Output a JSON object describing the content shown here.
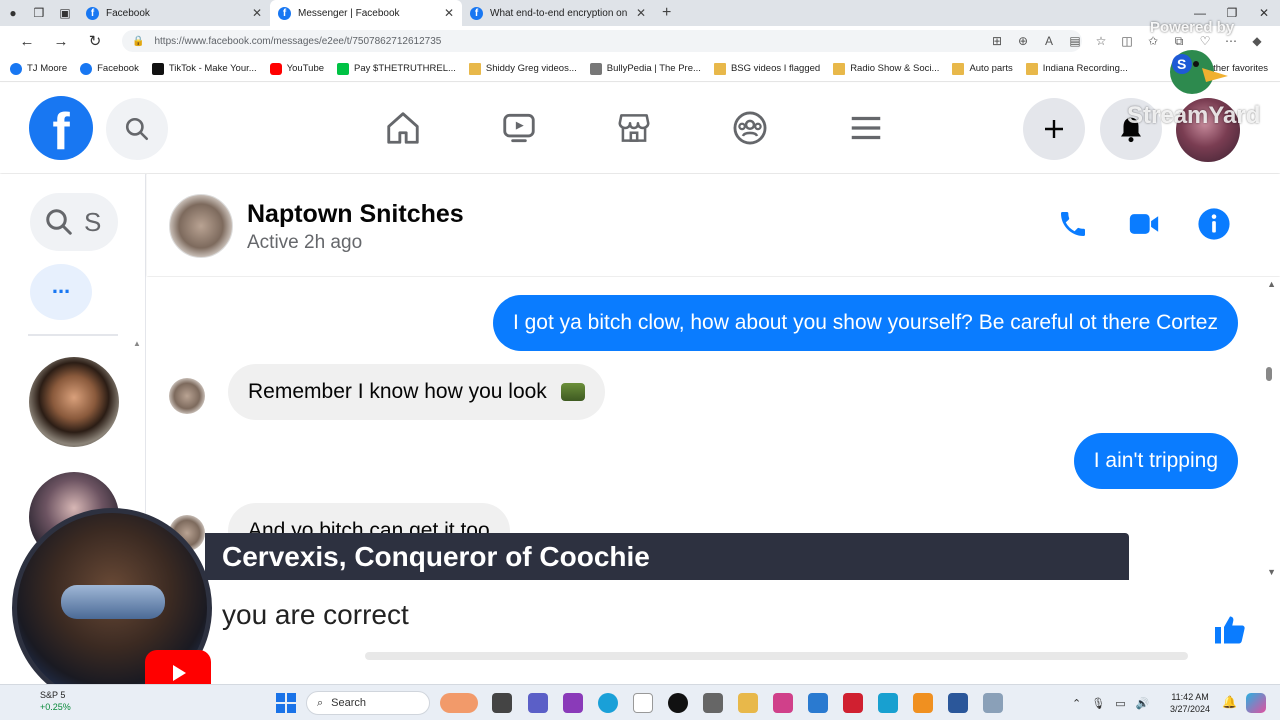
{
  "browser": {
    "tabs": [
      {
        "title": "Facebook",
        "active": false
      },
      {
        "title": "Messenger | Facebook",
        "active": true
      },
      {
        "title": "What end-to-end encryption on",
        "active": false
      }
    ],
    "url": "https://www.facebook.com/messages/e2ee/t/7507862712612735",
    "bookmarks": [
      "TJ Moore",
      "Facebook",
      "TikTok - Make Your...",
      "YouTube",
      "Pay $THETRUTHREL...",
      "Shiddy Greg videos...",
      "BullyPedia | The Pre...",
      "BSG videos I flagged",
      "Radio Show & Soci...",
      "Auto parts",
      "Indiana Recording..."
    ],
    "bookmarks_right": "ther favorites"
  },
  "facebook": {
    "logo_letter": "f",
    "brand_color": "#1877f2"
  },
  "left_rail": {
    "search_text": "S",
    "more_label": "..."
  },
  "conversation": {
    "name": "Naptown Snitches",
    "status": "Active 2h ago",
    "messages": [
      {
        "direction": "out",
        "text": "I got ya bitch clow, how about you show yourself? Be careful ot there Cortez"
      },
      {
        "direction": "in",
        "text": "Remember I know how you look"
      },
      {
        "direction": "out",
        "text": "I ain't tripping"
      },
      {
        "direction": "in",
        "text": "And yo bitch can get it too"
      }
    ]
  },
  "overlay": {
    "commenter_name": "Cervexis, Conqueror of Coochie",
    "comment": "you are correct",
    "watermark": "StreamYard",
    "powered_by": "Powered by"
  },
  "taskbar": {
    "stock_name": "S&P 5",
    "stock_change": "+0.25%",
    "search_label": "Search",
    "time": "11:42 AM",
    "date": "3/27/2024"
  }
}
